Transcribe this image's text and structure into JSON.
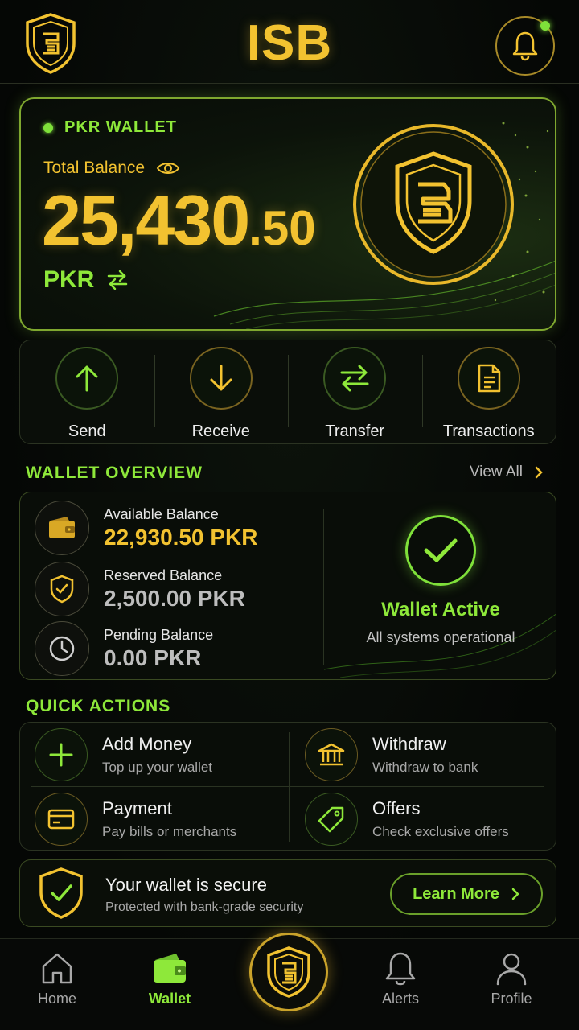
{
  "header": {
    "title": "ISB",
    "logo_icon": "shield-logo-icon",
    "notification_icon": "bell-icon"
  },
  "wallet_card": {
    "label": "PKR WALLET",
    "total_label": "Total Balance",
    "amount_main": "25,430",
    "amount_decimal": ".50",
    "currency": "PKR",
    "toggle_icon": "eye-icon",
    "swap_icon": "swap-arrows-icon"
  },
  "actions": [
    {
      "label": "Send",
      "icon": "arrow-up-icon"
    },
    {
      "label": "Receive",
      "icon": "arrow-down-icon"
    },
    {
      "label": "Transfer",
      "icon": "transfer-icon"
    },
    {
      "label": "Transactions",
      "icon": "document-icon"
    }
  ],
  "overview": {
    "title": "WALLET OVERVIEW",
    "view_all": "View All",
    "rows": [
      {
        "label": "Available Balance",
        "value": "22,930.50 PKR",
        "icon": "wallet-icon"
      },
      {
        "label": "Reserved Balance",
        "value": "2,500.00 PKR",
        "icon": "shield-check-icon"
      },
      {
        "label": "Pending Balance",
        "value": "0.00 PKR",
        "icon": "clock-icon"
      }
    ],
    "status_title": "Wallet Active",
    "status_sub": "All systems operational"
  },
  "quick_actions": {
    "title": "QUICK ACTIONS",
    "items": [
      {
        "title": "Add Money",
        "sub": "Top up your wallet",
        "icon": "plus-icon"
      },
      {
        "title": "Withdraw",
        "sub": "Withdraw to bank",
        "icon": "bank-icon"
      },
      {
        "title": "Payment",
        "sub": "Pay bills or merchants",
        "icon": "card-icon"
      },
      {
        "title": "Offers",
        "sub": "Check exclusive offers",
        "icon": "tag-icon"
      }
    ]
  },
  "secure": {
    "title": "Your wallet is secure",
    "sub": "Protected with bank-grade security",
    "button": "Learn More"
  },
  "nav": [
    {
      "label": "Home",
      "icon": "home-icon"
    },
    {
      "label": "Wallet",
      "icon": "wallet-icon"
    },
    {
      "label": "Alerts",
      "icon": "bell-icon"
    },
    {
      "label": "Profile",
      "icon": "user-icon"
    }
  ],
  "colors": {
    "gold": "#f2c230",
    "green": "#8ee83a",
    "background": "#050705"
  }
}
